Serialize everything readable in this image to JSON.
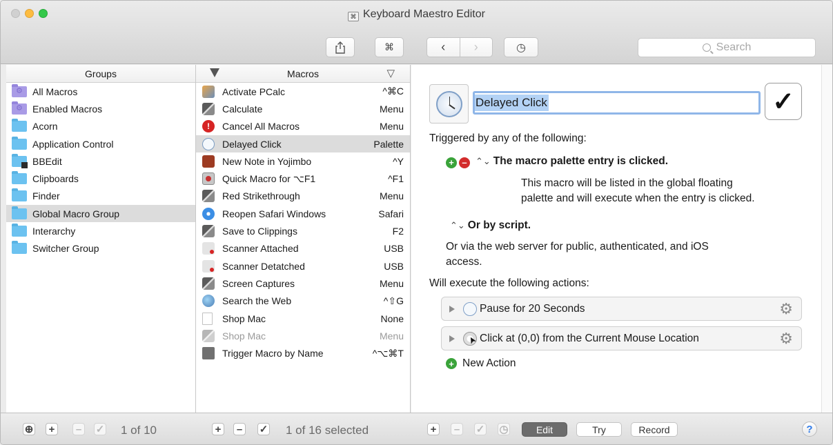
{
  "window": {
    "title": "Keyboard Maestro Editor",
    "controls": {
      "close": "close",
      "minimize": "minimize",
      "zoom": "zoom"
    }
  },
  "toolbar": {
    "share_icon": "share-icon",
    "command_glyph": "⌘",
    "back_glyph": "‹",
    "forward_glyph": "›",
    "history_glyph": "◷",
    "search_placeholder": "Search"
  },
  "groups": {
    "header": "Groups",
    "items": [
      {
        "label": "All Macros",
        "kind": "smart",
        "selected": false
      },
      {
        "label": "Enabled Macros",
        "kind": "smart",
        "selected": false
      },
      {
        "label": "Acorn",
        "kind": "folder",
        "selected": false
      },
      {
        "label": "Application Control",
        "kind": "folder",
        "selected": false
      },
      {
        "label": "BBEdit",
        "kind": "bbedit",
        "selected": false
      },
      {
        "label": "Clipboards",
        "kind": "folder",
        "selected": false
      },
      {
        "label": "Finder",
        "kind": "folder",
        "selected": false
      },
      {
        "label": "Global Macro Group",
        "kind": "folder",
        "selected": true
      },
      {
        "label": "Interarchy",
        "kind": "folder",
        "selected": false
      },
      {
        "label": "Switcher Group",
        "kind": "folder",
        "selected": false
      }
    ]
  },
  "macros": {
    "header": "Macros",
    "items": [
      {
        "name": "Activate PCalc",
        "trigger": "^⌘C",
        "icon": "pcalc-icon"
      },
      {
        "name": "Calculate",
        "trigger": "Menu",
        "icon": "stack-icon"
      },
      {
        "name": "Cancel All Macros",
        "trigger": "Menu",
        "icon": "stop-icon"
      },
      {
        "name": "Delayed Click",
        "trigger": "Palette",
        "icon": "clock-icon",
        "selected": true
      },
      {
        "name": "New Note in Yojimbo",
        "trigger": "^Y",
        "icon": "yojimbo-icon"
      },
      {
        "name": "Quick Macro for ⌥F1",
        "trigger": "^F1",
        "icon": "quick-macro-icon"
      },
      {
        "name": "Red Strikethrough",
        "trigger": "Menu",
        "icon": "stack-icon"
      },
      {
        "name": "Reopen Safari Windows",
        "trigger": "Safari",
        "icon": "safari-icon"
      },
      {
        "name": "Save to Clippings",
        "trigger": "F2",
        "icon": "stack-icon"
      },
      {
        "name": "Scanner Attached",
        "trigger": "USB",
        "icon": "usb-icon"
      },
      {
        "name": "Scanner Detatched",
        "trigger": "USB",
        "icon": "usb-icon"
      },
      {
        "name": "Screen Captures",
        "trigger": "Menu",
        "icon": "stack-icon"
      },
      {
        "name": "Search the Web",
        "trigger": "^⇧G",
        "icon": "globe-icon"
      },
      {
        "name": "Shop Mac",
        "trigger": "None",
        "icon": "document-icon"
      },
      {
        "name": "Shop Mac",
        "trigger": "Menu",
        "icon": "stack-icon",
        "dim": true
      },
      {
        "name": "Trigger Macro by Name",
        "trigger": "^⌥⌘T",
        "icon": "trigger-icon"
      }
    ]
  },
  "detail": {
    "macro_name": "Delayed Click",
    "enabled_glyph": "✓",
    "triggered_heading": "Triggered by any of the following:",
    "trigger_title": "The macro palette entry is clicked.",
    "trigger_desc_line1": "This macro will be listed in the global floating",
    "trigger_desc_line2": "palette and will execute when the entry is clicked.",
    "or_by_script": "Or by script.",
    "web_server_line1": "Or via the web server for public, authenticated, and iOS",
    "web_server_line2": "access.",
    "actions_heading": "Will execute the following actions:",
    "actions": [
      {
        "label": "Pause for 20 Seconds",
        "icon": "clock-icon"
      },
      {
        "label": "Click at (0,0) from the Current Mouse Location",
        "icon": "mouse-click-icon"
      }
    ],
    "new_action": "New Action"
  },
  "bottom": {
    "groups_count": "1 of 10",
    "macros_count": "1 of 16 selected",
    "edit": "Edit",
    "try": "Try",
    "record": "Record",
    "help": "?"
  }
}
